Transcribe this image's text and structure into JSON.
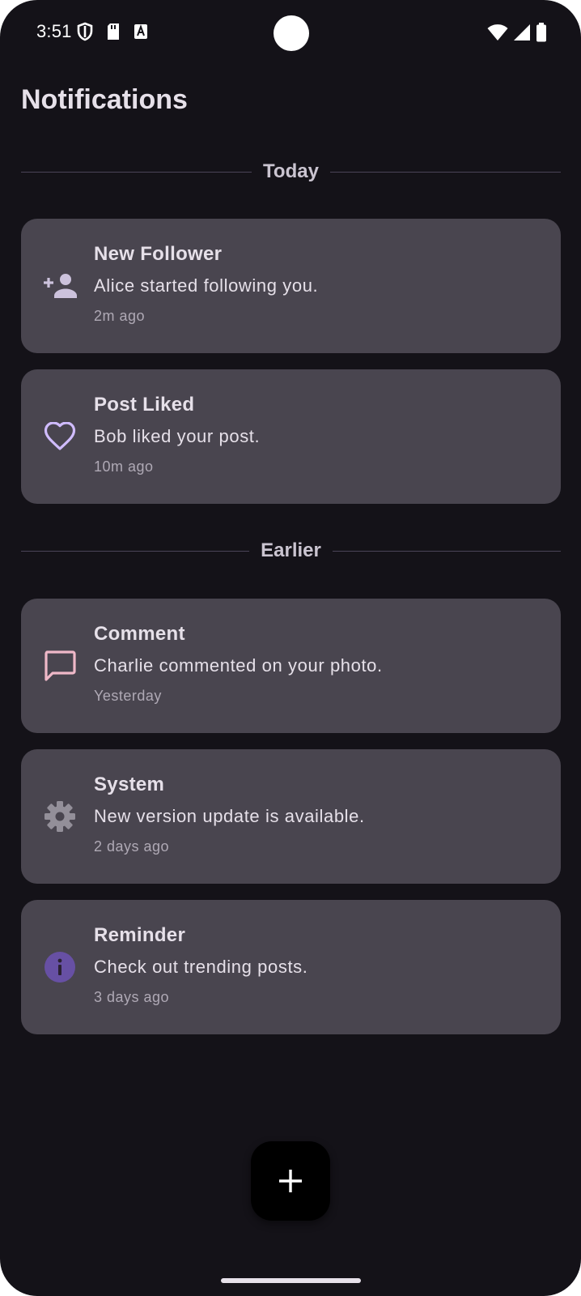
{
  "status_bar": {
    "time": "3:51",
    "left_icons": [
      "shield-icon",
      "sd-card-icon",
      "text-a-icon"
    ],
    "right_icons": [
      "wifi-icon",
      "cell-signal-icon",
      "battery-icon"
    ]
  },
  "header": {
    "title": "Notifications"
  },
  "sections": [
    {
      "label": "Today",
      "items": [
        {
          "icon": "person-add-icon",
          "icon_color": "#CCC2DC",
          "title": "New Follower",
          "message": "Alice started following you.",
          "time": "2m ago"
        },
        {
          "icon": "heart-outline-icon",
          "icon_color": "#D0BCFF",
          "title": "Post Liked",
          "message": "Bob liked your post.",
          "time": "10m ago"
        }
      ]
    },
    {
      "label": "Earlier",
      "items": [
        {
          "icon": "chat-bubble-icon",
          "icon_color": "#EFB8C8",
          "title": "Comment",
          "message": "Charlie commented on your photo.",
          "time": "Yesterday"
        },
        {
          "icon": "gear-icon",
          "icon_color": "#938F99",
          "title": "System",
          "message": "New version update is available.",
          "time": "2 days ago"
        },
        {
          "icon": "info-icon",
          "icon_color": "#6750A4",
          "title": "Reminder",
          "message": "Check out trending posts.",
          "time": "3 days ago"
        }
      ]
    }
  ],
  "fab": {
    "icon": "plus-icon"
  },
  "colors": {
    "background": "#141218",
    "card": "#49454F",
    "text_primary": "#E6E0E9",
    "text_secondary": "#AFA9B5",
    "divider": "#4A4458"
  }
}
